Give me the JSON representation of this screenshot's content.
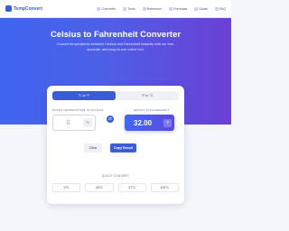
{
  "header": {
    "brand": "TempConvert",
    "nav": [
      {
        "label": "Converter",
        "icon": "thermometer-icon"
      },
      {
        "label": "Tools",
        "icon": "tools-icon"
      },
      {
        "label": "Reference",
        "icon": "book-icon"
      },
      {
        "label": "Formulas",
        "icon": "formula-icon"
      },
      {
        "label": "Guide",
        "icon": "guide-icon"
      },
      {
        "label": "FAQ",
        "icon": "question-icon"
      }
    ]
  },
  "hero": {
    "title": "Celsius to Fahrenheit Converter",
    "subtitle": "Convert temperatures between Celsius and Fahrenheit instantly with our free, accurate, and easy-to-use online tool."
  },
  "converter": {
    "tabs": [
      {
        "label": "°C to °F",
        "active": true
      },
      {
        "label": "°F to °C",
        "active": false
      }
    ],
    "input_label": "ENTER TEMPERATURE IN CELSIUS",
    "input_placeholder": "0",
    "input_unit": "°C",
    "swap_symbol": "⇄",
    "result_label": "RESULT IN FAHRENHEIT",
    "result_value": "32.00",
    "result_unit": "°F",
    "clear_label": "Clear",
    "copy_label": "Copy Result"
  },
  "quick": {
    "title": "QUICK CONVERT",
    "items": [
      "0°C",
      "25°C",
      "37°C",
      "100°C"
    ]
  },
  "colors": {
    "accent": "#3b5bdb",
    "hero_start": "#3f64f0",
    "hero_end": "#6b3fd6"
  }
}
